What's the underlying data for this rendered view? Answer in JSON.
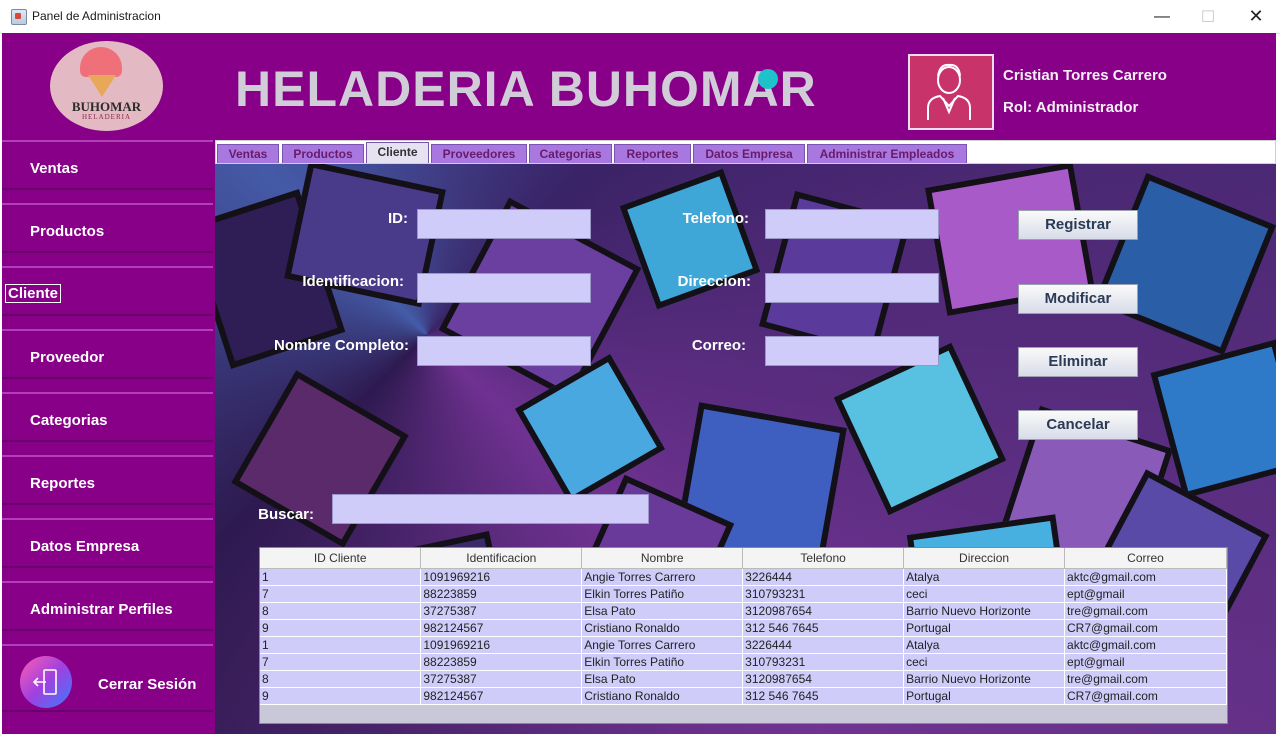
{
  "window": {
    "title": "Panel de Administracion",
    "minimize": "—",
    "maximize": "☐",
    "close": "✕"
  },
  "header": {
    "logo_text": "BUHOMAR",
    "logo_subtext": "HELADERIA",
    "brand": "HELADERIA BUHOMAR",
    "user_name": "Cristian Torres Carrero",
    "user_role": "Rol: Administrador"
  },
  "sidebar": {
    "items": [
      {
        "label": "Ventas"
      },
      {
        "label": "Productos"
      },
      {
        "label": "Cliente"
      },
      {
        "label": "Proveedor"
      },
      {
        "label": "Categorias"
      },
      {
        "label": "Reportes"
      },
      {
        "label": "Datos Empresa"
      },
      {
        "label": "Administrar Perfiles"
      }
    ],
    "logout_label": "Cerrar Sesión"
  },
  "tabs": [
    "Ventas",
    "Productos",
    "Cliente",
    "Proveedores",
    "Categorias",
    "Reportes",
    "Datos Empresa",
    "Administrar Empleados"
  ],
  "form": {
    "id_label": "ID:",
    "identificacion_label": "Identificacion:",
    "nombre_label": "Nombre Completo:",
    "telefono_label": "Telefono:",
    "direccion_label": "Direccion:",
    "correo_label": "Correo:",
    "buscar_label": "Buscar:",
    "id_value": "",
    "identificacion_value": "",
    "nombre_value": "",
    "telefono_value": "",
    "direccion_value": "",
    "correo_value": "",
    "buscar_value": ""
  },
  "buttons": {
    "registrar": "Registrar",
    "modificar": "Modificar",
    "eliminar": "Eliminar",
    "cancelar": "Cancelar"
  },
  "table": {
    "columns": [
      "ID Cliente",
      "Identificacion",
      "Nombre",
      "Telefono",
      "Direccion",
      "Correo"
    ],
    "rows": [
      [
        "1",
        "1091969216",
        "Angie Torres Carrero",
        "3226444",
        "Atalya",
        "aktc@gmail.com"
      ],
      [
        "7",
        "88223859",
        "Elkin Torres Patiño",
        "310793231",
        "ceci",
        "ept@gmail"
      ],
      [
        "8",
        "37275387",
        "Elsa Pato",
        "3120987654",
        "Barrio Nuevo Horizonte",
        "tre@gmail.com"
      ],
      [
        "9",
        "982124567",
        "Cristiano Ronaldo",
        "312 546 7645",
        "Portugal",
        "CR7@gmail.com"
      ],
      [
        "1",
        "1091969216",
        "Angie Torres Carrero",
        "3226444",
        "Atalya",
        "aktc@gmail.com"
      ],
      [
        "7",
        "88223859",
        "Elkin Torres Patiño",
        "310793231",
        "ceci",
        "ept@gmail"
      ],
      [
        "8",
        "37275387",
        "Elsa Pato",
        "3120987654",
        "Barrio Nuevo Horizonte",
        "tre@gmail.com"
      ],
      [
        "9",
        "982124567",
        "Cristiano Ronaldo",
        "312 546 7645",
        "Portugal",
        "CR7@gmail.com"
      ]
    ]
  },
  "colors": {
    "primary": "#880088",
    "field": "#d0ccfa",
    "tab": "#a878e0"
  }
}
